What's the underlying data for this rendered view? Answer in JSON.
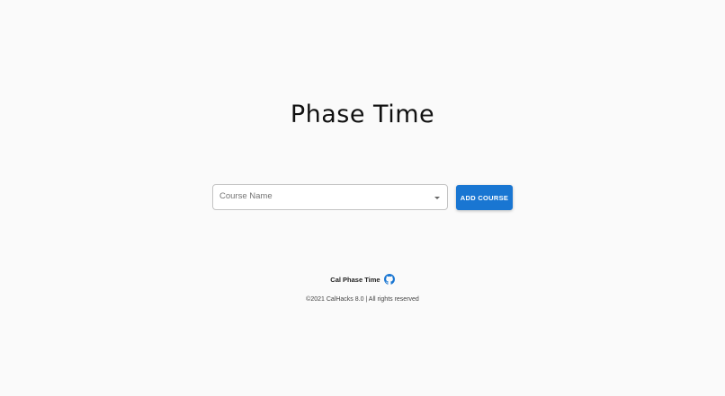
{
  "app": {
    "title": "Phase Time"
  },
  "course_picker": {
    "placeholder": "Course Name",
    "selected_value": ""
  },
  "actions": {
    "add_course_label": "ADD COURSE"
  },
  "footer": {
    "brand": "Cal Phase Time",
    "brand_icon": "github-icon",
    "copyright": "©2021 CalHacks 8.0 | All rights reserved"
  },
  "colors": {
    "accent": "#1976d2",
    "background": "#fafafa"
  }
}
